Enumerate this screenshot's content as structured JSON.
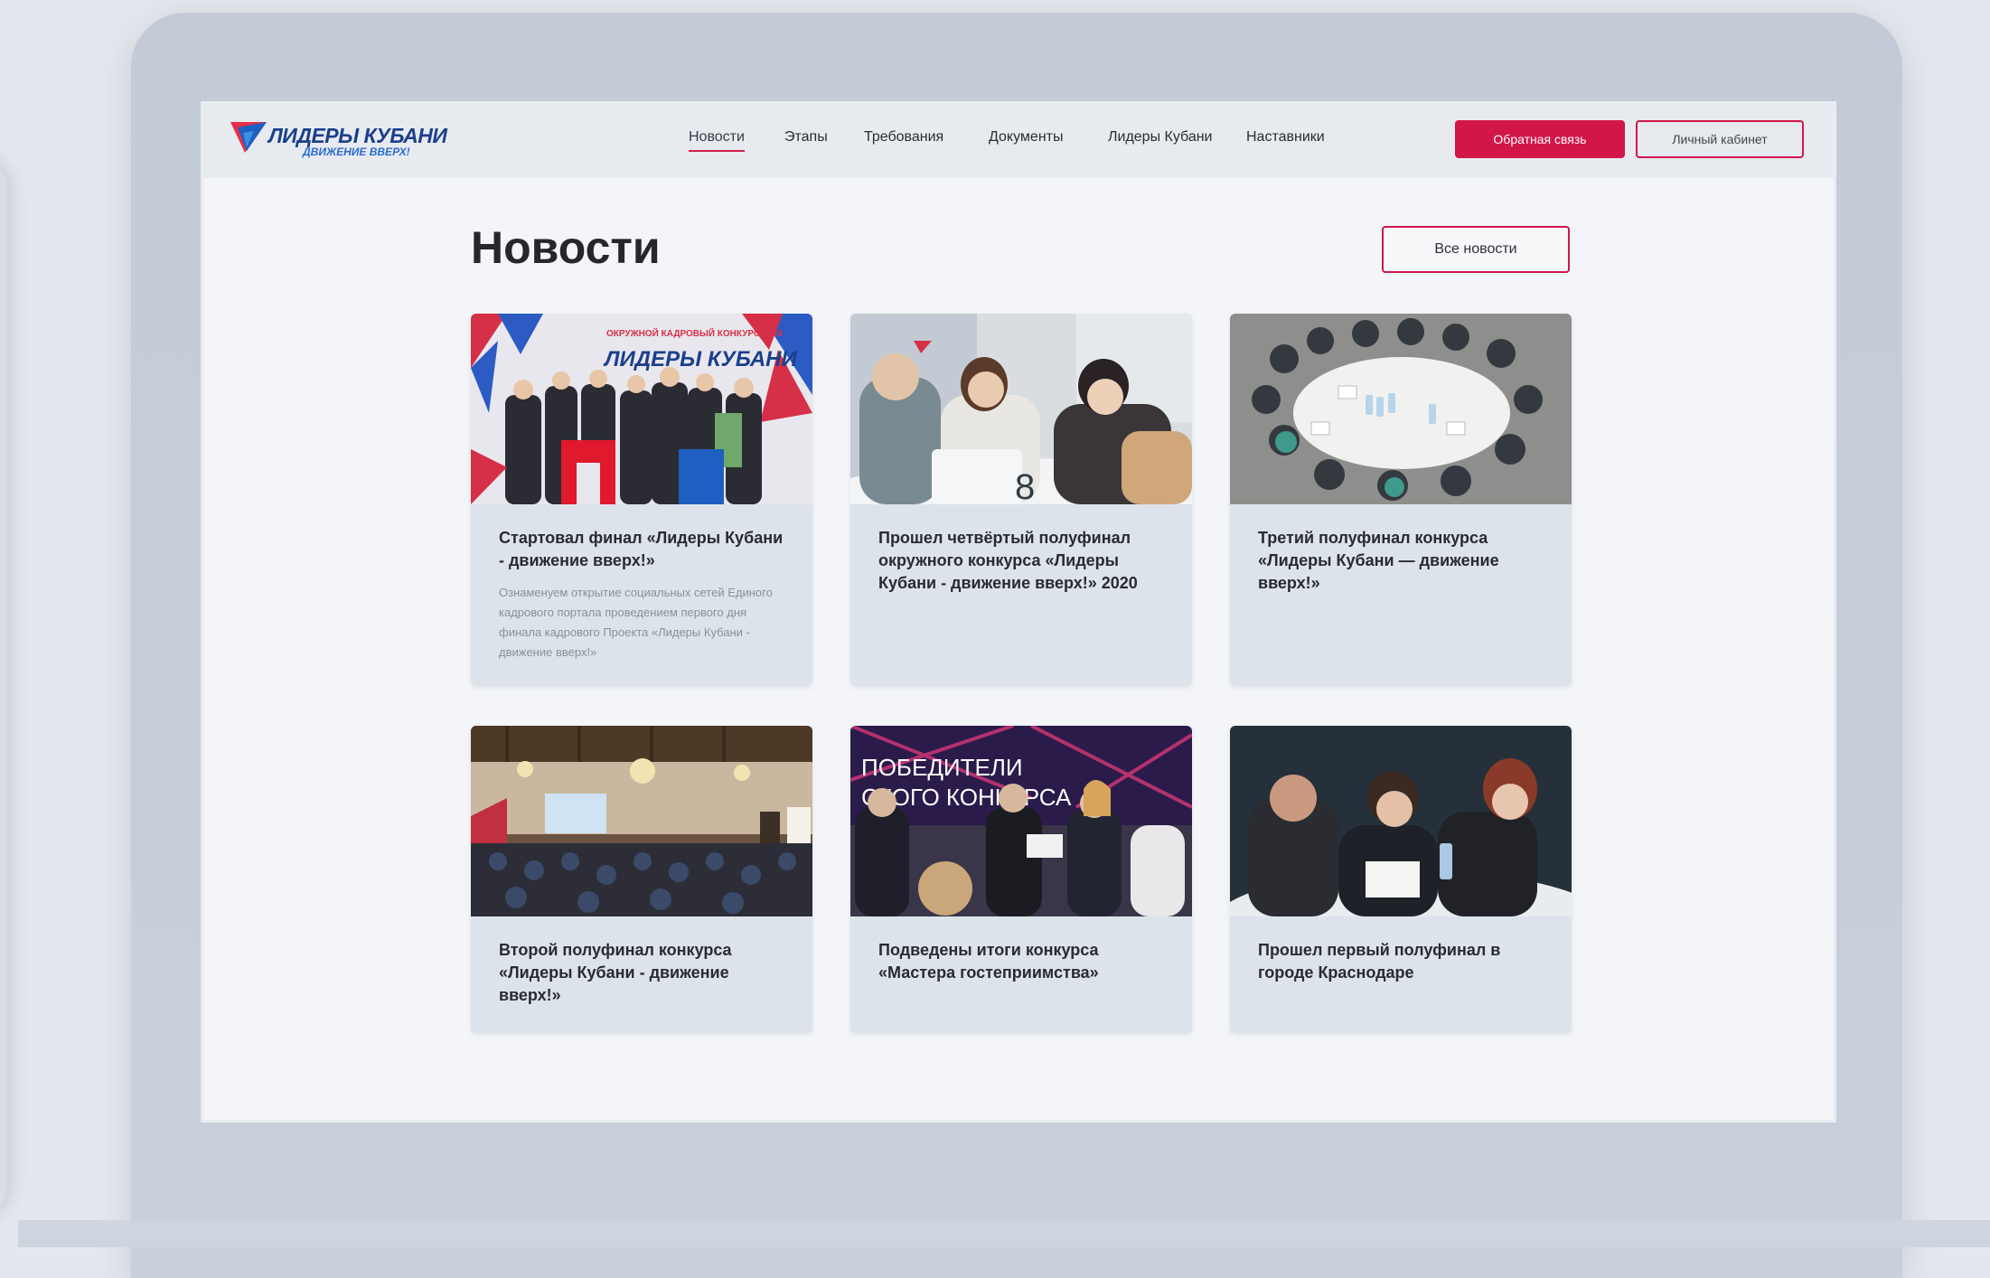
{
  "logo": {
    "title": "ЛИДЕРЫ КУБАНИ",
    "subtitle": "ДВИЖЕНИЕ ВВЕРХ!"
  },
  "nav": [
    "Новости",
    "Этапы",
    "Требования",
    "Документы",
    "Лидеры Кубани",
    "Наставники"
  ],
  "header_buttons": {
    "feedback": "Обратная связь",
    "cabinet": "Личный кабинет"
  },
  "page": {
    "title": "Новости",
    "all_news": "Все новости"
  },
  "news": [
    {
      "title": "Стартовал финал «Лидеры Кубани - движение вверх!»",
      "description": "Ознаменуем открытие социальных сетей Единого кадрового портала проведением первого дня финала кадрового Проекта «Лидеры Кубани - движение вверх!»",
      "photo_text": "ЛИДЕРЫ КУБАНИ",
      "photo_subtext": "ОКРУЖНОЙ КАДРОВЫЙ КОНКУРС 2020"
    },
    {
      "title": "Прошел четвёртый полуфинал окружного конкурса «Лидеры Кубани - движение вверх!» 2020",
      "photo_text": "8"
    },
    {
      "title": "Третий полуфинал конкурса «Лидеры Кубани — движение вверх!»"
    },
    {
      "title": "Второй полуфинал конкурса «Лидеры Кубани - движение вверх!»"
    },
    {
      "title": "Подведены итоги конкурса «Мастера гостеприимства»",
      "photo_text": "ПОБЕДИТЕЛИ",
      "photo_subtext": "СКОГО КОНКУРСА"
    },
    {
      "title": "Прошел первый полуфинал в городе Краснодаре"
    }
  ],
  "colors": {
    "accent": "#d2164a",
    "brand_blue": "#1b3f8c",
    "text": "#26262c"
  }
}
